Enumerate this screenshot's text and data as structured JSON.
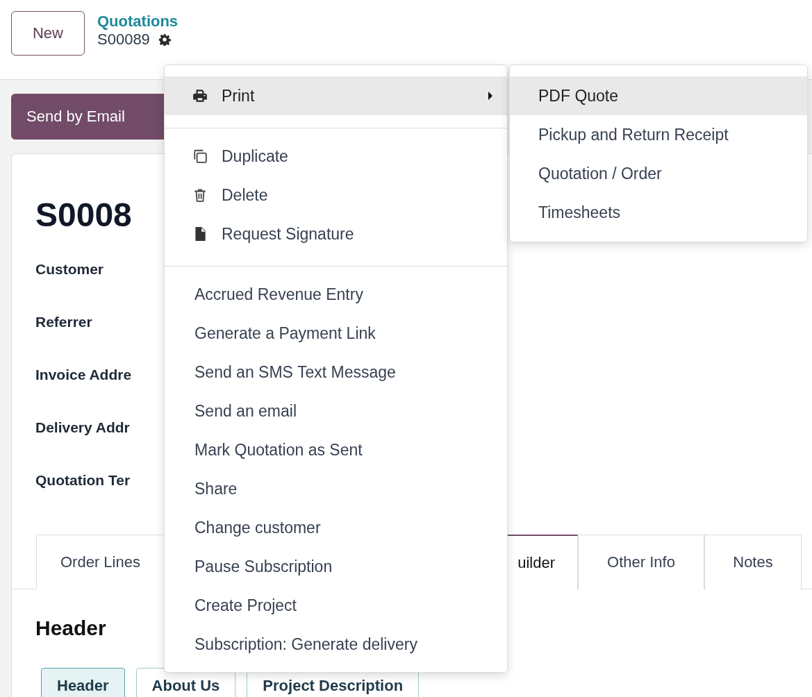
{
  "control_panel": {
    "new_button": "New",
    "breadcrumb": "Quotations",
    "record": "S00089"
  },
  "status_bar": {
    "send_button": "Send by Email"
  },
  "form": {
    "title": "S0008",
    "fields": [
      "Customer",
      "Referrer",
      "Invoice Addre",
      "Delivery Addr",
      "Quotation Ter"
    ]
  },
  "tabs": [
    {
      "label": "Order Lines",
      "selected": false
    },
    {
      "label": "uilder",
      "selected": true
    },
    {
      "label": "Other Info",
      "selected": false
    },
    {
      "label": "Notes",
      "selected": false
    }
  ],
  "section_title": "Header",
  "sub_tabs": [
    {
      "label": "Header",
      "selected": true
    },
    {
      "label": "About Us",
      "selected": false
    },
    {
      "label": "Project Description",
      "selected": false
    }
  ],
  "menu": {
    "groups": [
      [
        {
          "label": "Print",
          "kind": "print",
          "selected": true
        }
      ],
      [
        {
          "label": "Duplicate",
          "kind": "duplicate",
          "selected": false
        },
        {
          "label": "Delete",
          "kind": "delete",
          "selected": false
        },
        {
          "label": "Request Signature",
          "kind": "signature",
          "selected": false
        }
      ],
      [
        {
          "label": "Accrued Revenue Entry",
          "kind": "plain",
          "selected": false
        },
        {
          "label": "Generate a Payment Link",
          "kind": "plain",
          "selected": false
        },
        {
          "label": "Send an SMS Text Message",
          "kind": "plain",
          "selected": false
        },
        {
          "label": "Send an email",
          "kind": "plain",
          "selected": false
        },
        {
          "label": "Mark Quotation as Sent",
          "kind": "plain",
          "selected": false
        },
        {
          "label": "Share",
          "kind": "plain",
          "selected": false
        },
        {
          "label": "Change customer",
          "kind": "plain",
          "selected": false
        },
        {
          "label": "Pause Subscription",
          "kind": "plain",
          "selected": false
        },
        {
          "label": "Create Project",
          "kind": "plain",
          "selected": false
        },
        {
          "label": "Subscription: Generate delivery",
          "kind": "plain",
          "selected": false
        }
      ]
    ]
  },
  "submenu": [
    {
      "label": "PDF Quote",
      "selected": true
    },
    {
      "label": "Pickup and Return Receipt",
      "selected": false
    },
    {
      "label": "Quotation / Order",
      "selected": false
    },
    {
      "label": "Timesheets",
      "selected": false
    }
  ]
}
